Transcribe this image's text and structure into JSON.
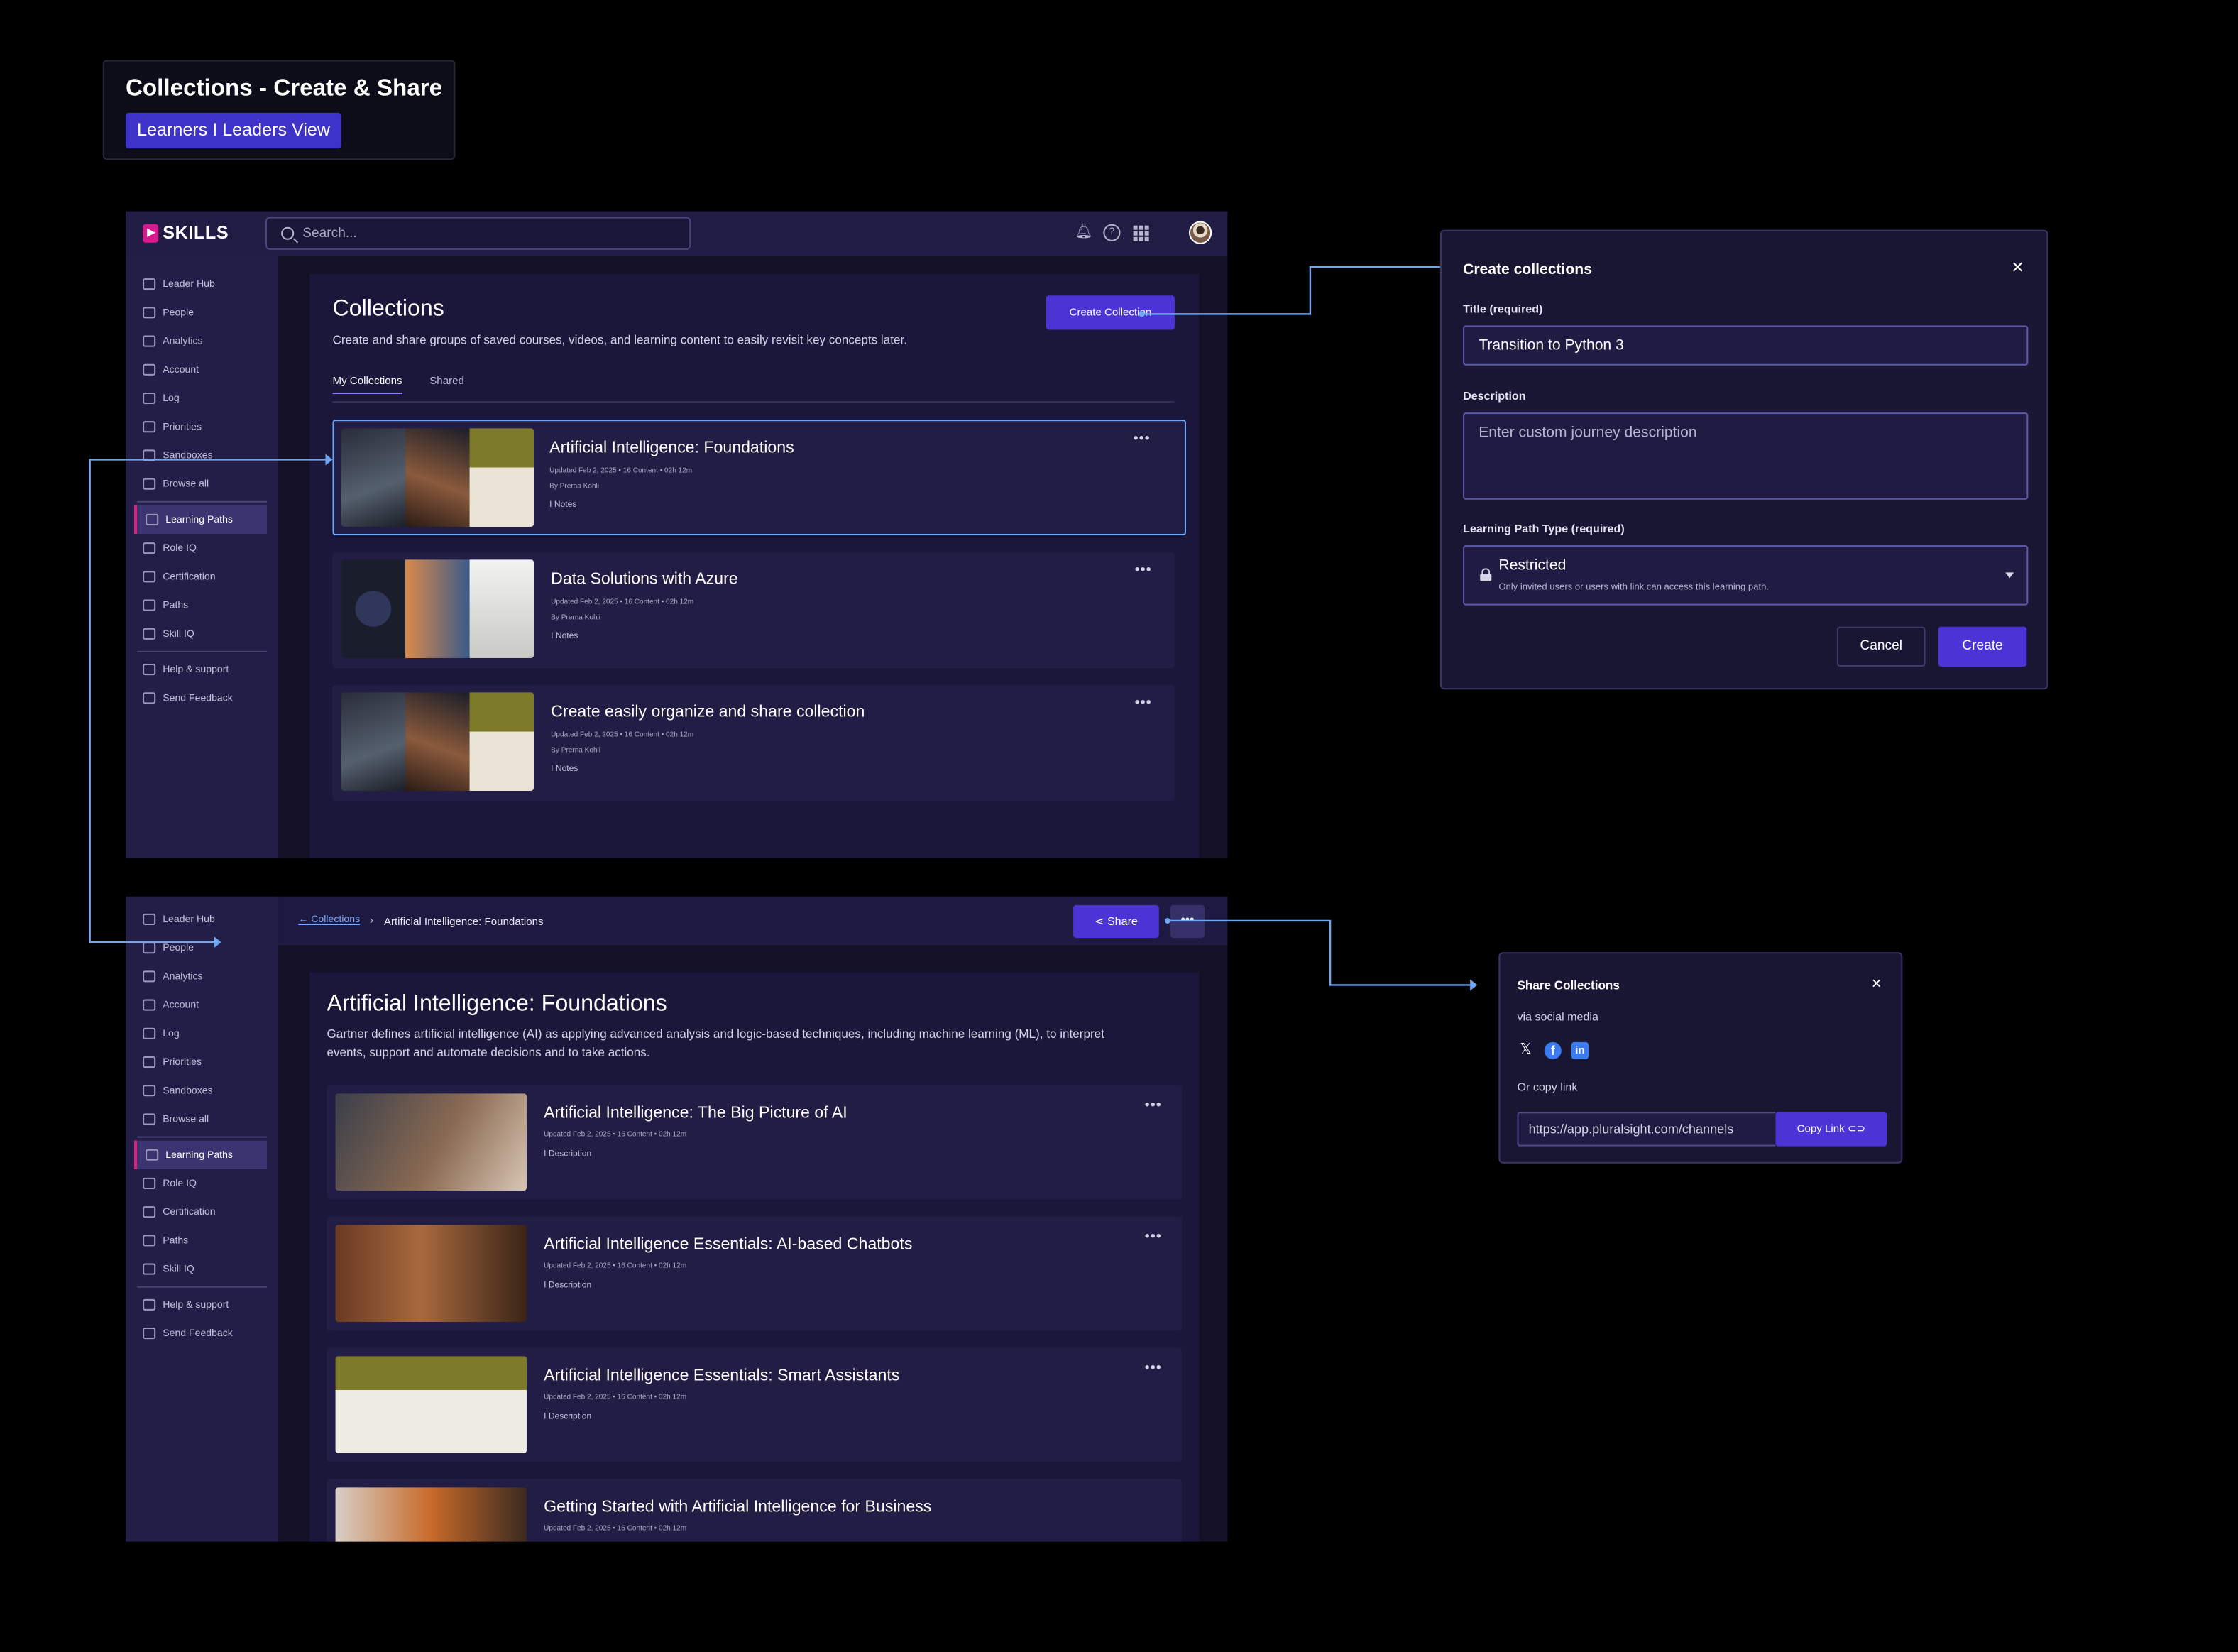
{
  "header": {
    "title": "Collections - Create & Share",
    "badge": "Learners I Leaders View"
  },
  "brand": {
    "name": "SKILLS",
    "accent": "#d61a8e",
    "primary": "#4b34d6"
  },
  "search": {
    "placeholder": "Search..."
  },
  "sidebar": {
    "group1": [
      "Leader Hub",
      "People",
      "Analytics",
      "Account",
      "Log",
      "Priorities",
      "Sandboxes",
      "Browse all"
    ],
    "group2": [
      "Learning Paths",
      "Role IQ",
      "Certification",
      "Paths",
      "Skill IQ"
    ],
    "group3": [
      "Help & support",
      "Send Feedback"
    ],
    "active": "Learning Paths"
  },
  "collections": {
    "title": "Collections",
    "description": "Create and share groups of saved courses, videos, and learning content to easily revisit key concepts later.",
    "create_button": "Create Collection",
    "tabs": [
      "My Collections",
      "Shared"
    ],
    "items": [
      {
        "title": "Artificial Intelligence: Foundations",
        "meta": "Updated Feb 2, 2025  •  16 Content  •  02h 12m",
        "by": "By Prerna Kohli",
        "notes": "I Notes"
      },
      {
        "title": "Data Solutions with Azure",
        "meta": "Updated Feb 2, 2025  •  16 Content  •  02h 12m",
        "by": "By Prerna Kohli",
        "notes": "I Notes"
      },
      {
        "title": "Create easily organize and share collection",
        "meta": "Updated Feb 2, 2025  •  16 Content  •  02h 12m",
        "by": "By Prerna Kohli",
        "notes": "I Notes"
      }
    ]
  },
  "detail": {
    "breadcrumb_link": "Collections",
    "breadcrumb_current": "Artificial Intelligence: Foundations",
    "share_button": "Share",
    "title": "Artificial Intelligence: Foundations",
    "description": "Gartner defines artificial intelligence (AI) as applying advanced analysis and logic-based techniques, including machine learning (ML), to interpret events, support and automate decisions and to take actions.",
    "items": [
      {
        "title": "Artificial Intelligence: The Big Picture of AI",
        "meta": "Updated Feb 2, 2025  •  16 Content  •  02h 12m",
        "desc": "I Description"
      },
      {
        "title": "Artificial Intelligence Essentials: AI-based Chatbots",
        "meta": "Updated Feb 2, 2025  •  16 Content  •  02h 12m",
        "desc": "I Description"
      },
      {
        "title": "Artificial Intelligence Essentials: Smart Assistants",
        "meta": "Updated Feb 2, 2025  •  16 Content  •  02h 12m",
        "desc": "I Description"
      },
      {
        "title": "Getting Started with Artificial Intelligence for Business",
        "meta": "Updated Feb 2, 2025  •  16 Content  •  02h 12m",
        "desc": ""
      }
    ]
  },
  "create_dialog": {
    "title": "Create collections",
    "title_label": "Title (required)",
    "title_value": "Transition to Python 3",
    "desc_label": "Description",
    "desc_placeholder": "Enter custom journey description",
    "type_label": "Learning Path Type (required)",
    "type_value": "Restricted",
    "type_sub": "Only invited users or users with link can access this learning path.",
    "cancel": "Cancel",
    "create": "Create"
  },
  "share_dialog": {
    "title": "Share Collections",
    "via": "via social media",
    "social": [
      "x-icon",
      "facebook-icon",
      "linkedin-icon"
    ],
    "or_copy": "Or copy link",
    "link": "https://app.pluralsight.com/channels",
    "copy_button": "Copy Link"
  }
}
